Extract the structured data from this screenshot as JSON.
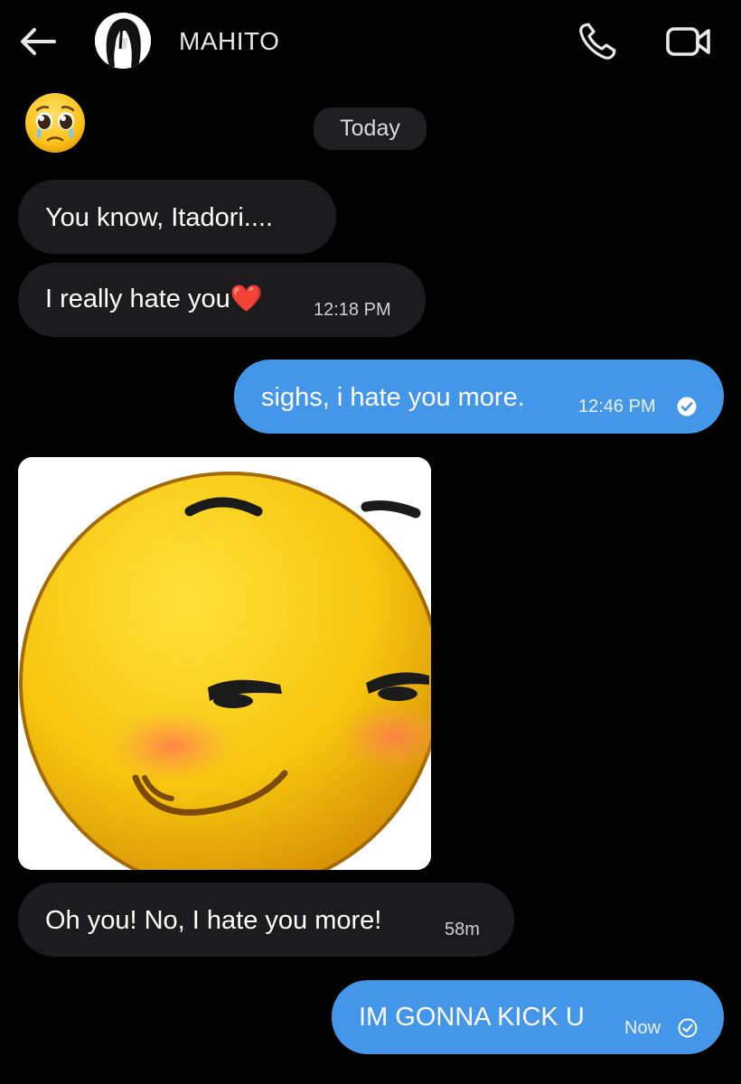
{
  "header": {
    "contact_name": "MAHITO",
    "back_icon": "arrow-left-icon",
    "call_icon": "phone-icon",
    "video_icon": "video-camera-icon"
  },
  "reaction": {
    "emoji": "🥺"
  },
  "date_label": "Today",
  "messages": [
    {
      "direction": "incoming",
      "text": "You know, Itadori...."
    },
    {
      "direction": "incoming",
      "text": "I really hate you❤️",
      "time": "12:18 PM"
    },
    {
      "direction": "outgoing",
      "text": "sighs, i hate you more.",
      "time": "12:46 PM",
      "status": "read"
    },
    {
      "direction": "incoming",
      "type": "image",
      "image_description_icon": "blushing-smirk-emoji-image"
    },
    {
      "direction": "incoming",
      "text": "Oh you! No, I hate you more!",
      "time": "58m"
    },
    {
      "direction": "outgoing",
      "text": "IM GONNA KICK U",
      "time": "Now",
      "status": "sent"
    }
  ],
  "colors": {
    "background": "#000000",
    "incoming_bubble": "#1c1c1e",
    "outgoing_bubble": "#4396e8",
    "date_chip": "#1f1f21"
  }
}
